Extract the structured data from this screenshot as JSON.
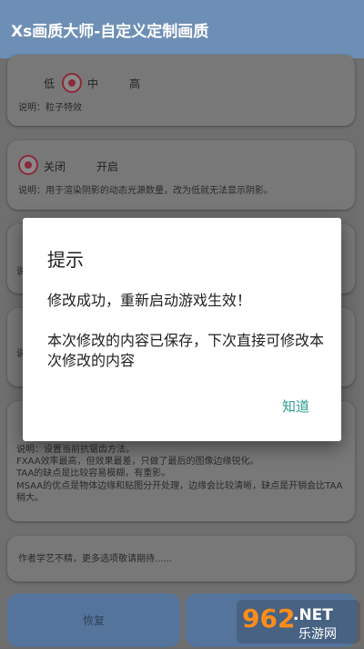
{
  "appbar": {
    "title": "Xs画质大师-自定义定制画质"
  },
  "card1": {
    "options": [
      "低",
      "中",
      "高"
    ],
    "selected": "中",
    "desc": "说明：粒子特效"
  },
  "card2": {
    "options": [
      "关闭",
      "开启"
    ],
    "selected": "关闭",
    "desc": "说明：用于渲染阴影的动态光源数量，改为低就无法显示阴影。"
  },
  "card3": {
    "desc_prefix": "说"
  },
  "card4": {
    "desc_prefix": "说"
  },
  "card5": {
    "desc_lines": [
      "说明：设置当前抗锯齿方法。",
      "FXAA效率最高，但效果最差，只做了最后的图像边缘锐化。",
      "TAA的缺点是比较容易模糊，有重影。",
      "MSAA的优点是物体边缘和贴图分开处理，边缘会比较清晰，缺点是开销会比TAA稍大。"
    ]
  },
  "card6": {
    "text": "作者学艺不精，更多选项敬请期待......"
  },
  "buttons": {
    "restore": "恢复"
  },
  "dialog": {
    "title": "提示",
    "line1": "修改成功，重新启动游戏生效！",
    "line2": "本次修改的内容已保存，下次直接可修改本次修改的内容",
    "ok": "知道"
  },
  "watermark": {
    "number": "962",
    "suffix": ".NET",
    "sub": "乐游网"
  },
  "colors": {
    "appbar": "#6e8fb5",
    "accent": "#8a2a3a",
    "dialog_ok": "#2a9d8f"
  }
}
